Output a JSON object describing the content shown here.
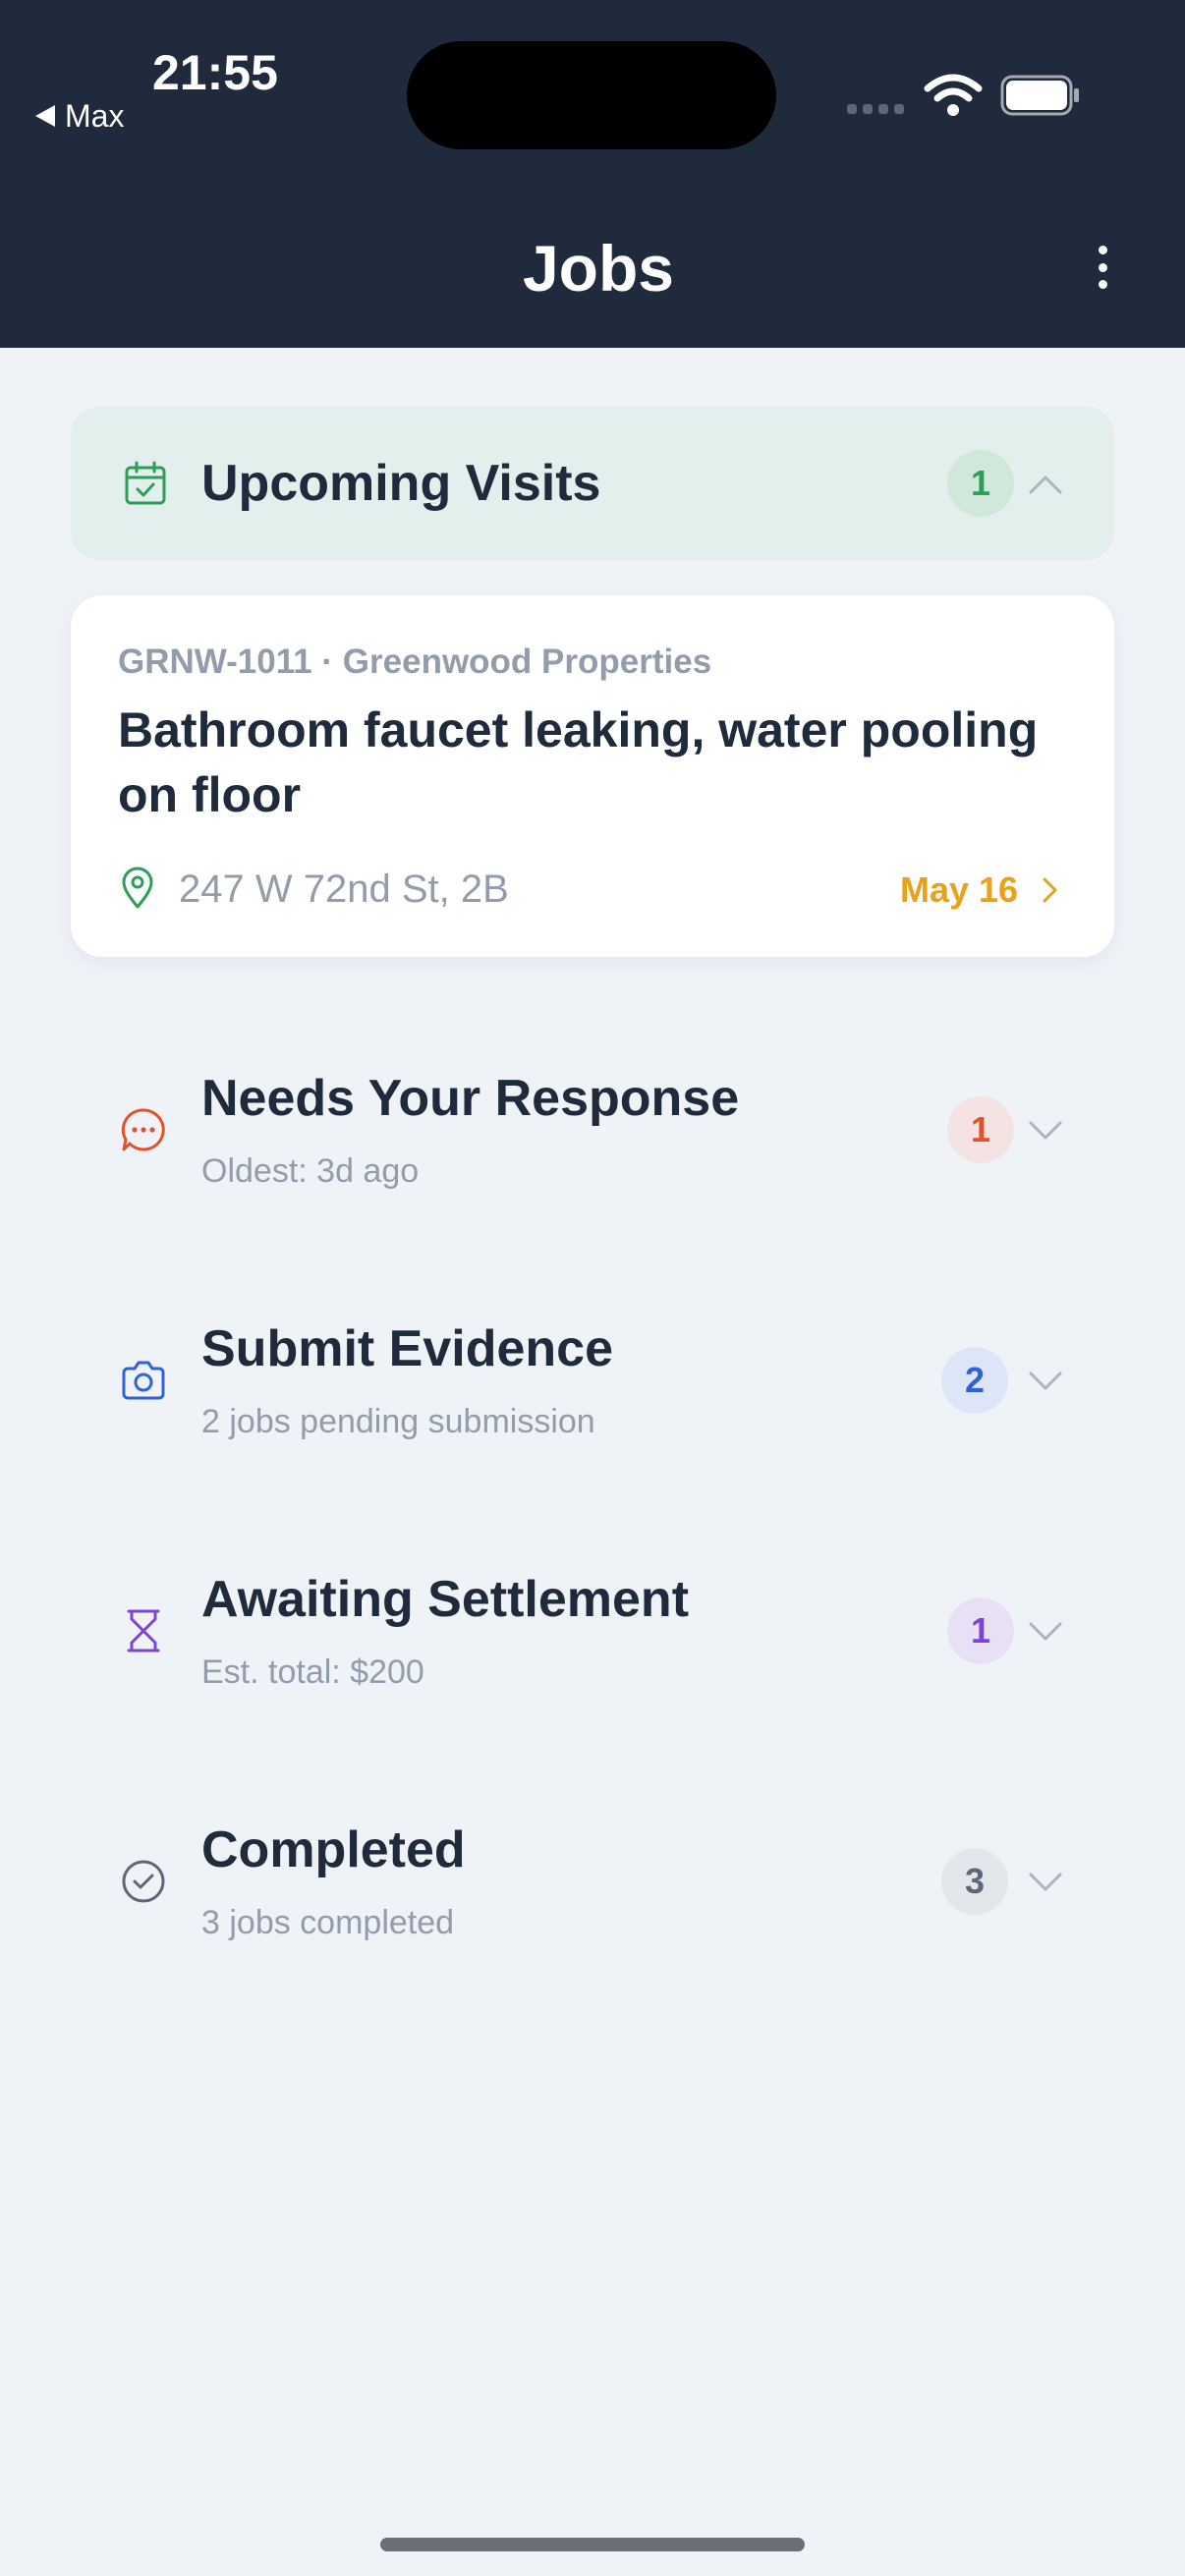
{
  "status_bar": {
    "time": "21:55",
    "back_app": "Max"
  },
  "header": {
    "title": "Jobs"
  },
  "sections": {
    "upcoming": {
      "title": "Upcoming Visits",
      "count": "1",
      "icon": "calendar-check-icon",
      "color": "#2e9e57",
      "badge_bg": "#cfe8d9",
      "expanded": true
    },
    "needs_response": {
      "title": "Needs Your Response",
      "subtitle": "Oldest: 3d ago",
      "count": "1",
      "icon": "chat-bubble-icon",
      "color": "#e0522a",
      "badge_bg": "#f5e3e3"
    },
    "submit_evidence": {
      "title": "Submit Evidence",
      "subtitle": "2 jobs pending submission",
      "count": "2",
      "icon": "camera-icon",
      "color": "#2f62d6",
      "badge_bg": "#dce6f7"
    },
    "awaiting_settlement": {
      "title": "Awaiting Settlement",
      "subtitle": "Est. total: $200",
      "count": "1",
      "icon": "hourglass-icon",
      "color": "#7c44d6",
      "badge_bg": "#e8e1f6"
    },
    "completed": {
      "title": "Completed",
      "subtitle": "3 jobs completed",
      "count": "3",
      "icon": "check-circle-icon",
      "color": "#5d6779",
      "badge_bg": "#e3e7ec"
    }
  },
  "upcoming_job": {
    "meta": "GRNW-1011 · Greenwood Properties",
    "title": "Bathroom faucet leaking, water pooling on floor",
    "address": "247 W 72nd St, 2B",
    "date": "May 16"
  }
}
